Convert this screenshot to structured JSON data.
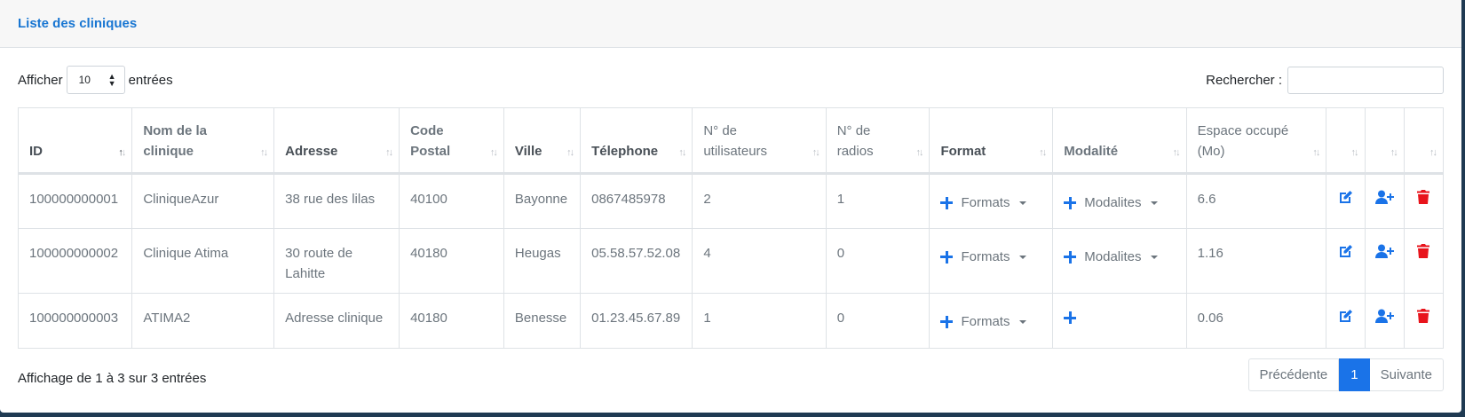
{
  "card": {
    "title": "Liste des cliniques"
  },
  "length": {
    "label_before": "Afficher",
    "value": "10",
    "label_after": "entrées"
  },
  "search": {
    "label": "Rechercher :",
    "value": ""
  },
  "table": {
    "columns": [
      "ID",
      "Nom de la clinique",
      "Adresse",
      "Code Postal",
      "Ville",
      "Télephone",
      "N° de utilisateurs",
      "N° de radios",
      "Format",
      "Modalité",
      "Espace occupé (Mo)",
      "",
      "",
      ""
    ],
    "rows": [
      {
        "id": "100000000001",
        "name": "CliniqueAzur",
        "address": "38 rue des lilas",
        "postal": "40100",
        "city": "Bayonne",
        "phone": "0867485978",
        "users": "2",
        "radios": "1",
        "format_label": "Formats",
        "modality_label": "Modalites",
        "space": "6.6"
      },
      {
        "id": "100000000002",
        "name": "Clinique Atima",
        "address": "30 route de Lahitte",
        "postal": "40180",
        "city": "Heugas",
        "phone": "05.58.57.52.08",
        "users": "4",
        "radios": "0",
        "format_label": "Formats",
        "modality_label": "Modalites",
        "space": "1.16"
      },
      {
        "id": "100000000003",
        "name": "ATIMA2",
        "address": "Adresse clinique",
        "postal": "40180",
        "city": "Benesse",
        "phone": "01.23.45.67.89",
        "users": "1",
        "radios": "0",
        "format_label": "Formats",
        "modality_label": "",
        "space": "0.06"
      }
    ]
  },
  "footer": {
    "info": "Affichage de 1 à 3 sur 3 entrées",
    "prev": "Précédente",
    "current": "1",
    "next": "Suivante"
  },
  "colors": {
    "accent": "#1a73e8",
    "danger": "#e8141c",
    "title": "#1976d2"
  },
  "icons": [
    "edit-icon",
    "user-plus-icon",
    "trash-icon",
    "plus-icon",
    "caret-down-icon",
    "sort-icon"
  ]
}
